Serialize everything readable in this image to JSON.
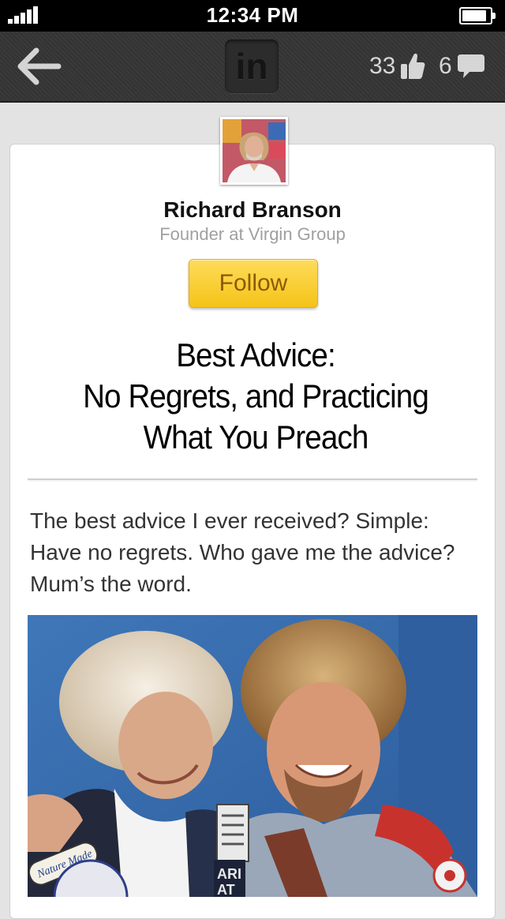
{
  "status_bar": {
    "time": "12:34 PM"
  },
  "nav": {
    "logo_text": "in",
    "likes_count": "33",
    "comments_count": "6"
  },
  "author": {
    "name": "Richard Branson",
    "title": "Founder at Virgin Group",
    "follow_label": "Follow"
  },
  "article": {
    "headline_lines": [
      "Best Advice:",
      "No Regrets, and Practicing",
      "What You Preach"
    ],
    "intro": "The best advice I ever received? Simple: Have no regrets. Who gave me the advice? Mum’s the word."
  },
  "photo": {
    "patch_text_1": "Nature Made",
    "patch_text_2": "ARI\nAT"
  },
  "colors": {
    "follow_button": "#f5c318",
    "follow_text": "#8b5a06",
    "nav_bar": "#353535"
  }
}
